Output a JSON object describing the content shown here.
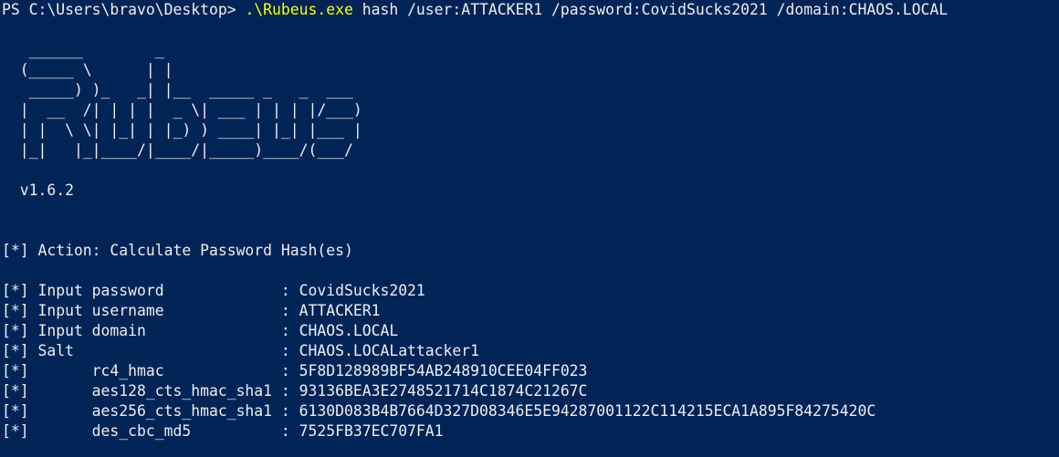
{
  "colors": {
    "background": "#012456",
    "foreground": "#eeedf0",
    "command_highlight": "#ffff00"
  },
  "prompt": {
    "prefix": "PS C:\\Users\\bravo\\Desktop> ",
    "executable": ".\\Rubeus.exe",
    "arguments": " hash /user:ATTACKER1 /password:CovidSucks2021 /domain:CHAOS.LOCAL"
  },
  "banner": {
    "art": "   ______        _\n  (_____ \\      | |\n   _____) )_   _| |__  _____ _   _  ___\n  |  __  /| | | |  _ \\| ___ | | | |/___)\n  | |  \\ \\| |_| | |_) ) ____| |_| |___ |\n  |_|   |_|____/|____/|_____)____/(___/",
    "version": "  v1.6.2"
  },
  "action_line": "[*] Action: Calculate Password Hash(es)",
  "output_lines": [
    "[*] Input password             : CovidSucks2021",
    "[*] Input username             : ATTACKER1",
    "[*] Input domain               : CHAOS.LOCAL",
    "[*] Salt                       : CHAOS.LOCALattacker1",
    "[*]       rc4_hmac             : 5F8D128989BF54AB248910CEE04FF023",
    "[*]       aes128_cts_hmac_sha1 : 93136BEA3E2748521714C1874C21267C",
    "[*]       aes256_cts_hmac_sha1 : 6130D083B4B7664D327D08346E5E94287001122C114215ECA1A895F84275420C",
    "[*]       des_cbc_md5          : 7525FB37EC707FA1"
  ]
}
